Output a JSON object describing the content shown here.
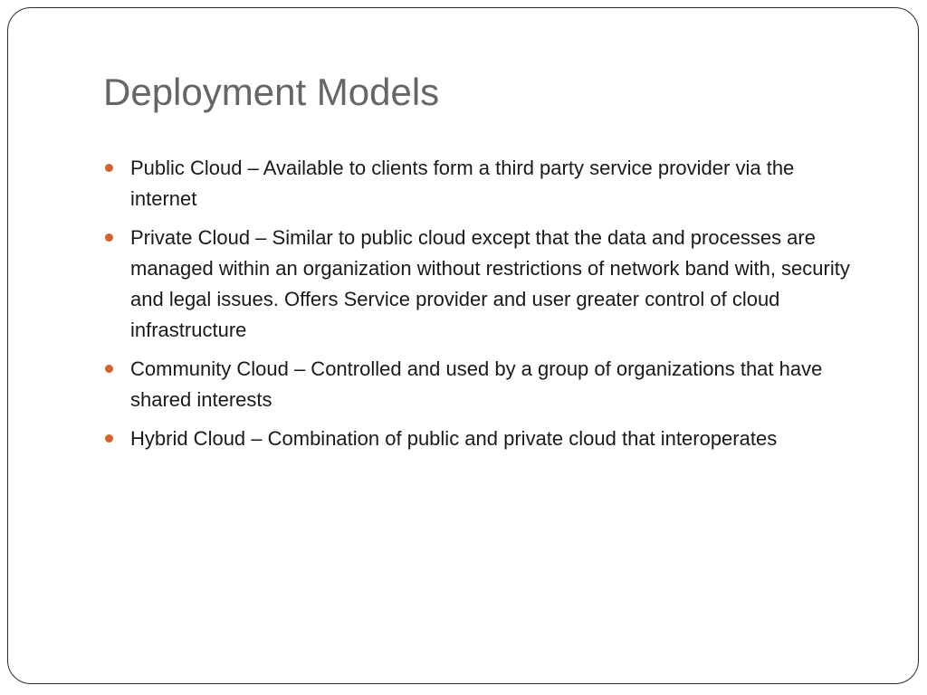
{
  "slide": {
    "title": "Deployment Models",
    "bullet_color": "#d4622b",
    "title_color": "#666666",
    "bullets": [
      {
        "text": "Public Cloud – Available to clients form a third party service provider via the internet"
      },
      {
        "text": "Private Cloud – Similar to public cloud except that the data and processes are managed within an organization without restrictions of network band with, security and legal issues. Offers Service provider and user greater control of cloud infrastructure"
      },
      {
        "text": "Community Cloud – Controlled and used by a group of organizations that have shared interests"
      },
      {
        "text": "Hybrid Cloud – Combination of public and private cloud that interoperates"
      }
    ]
  }
}
